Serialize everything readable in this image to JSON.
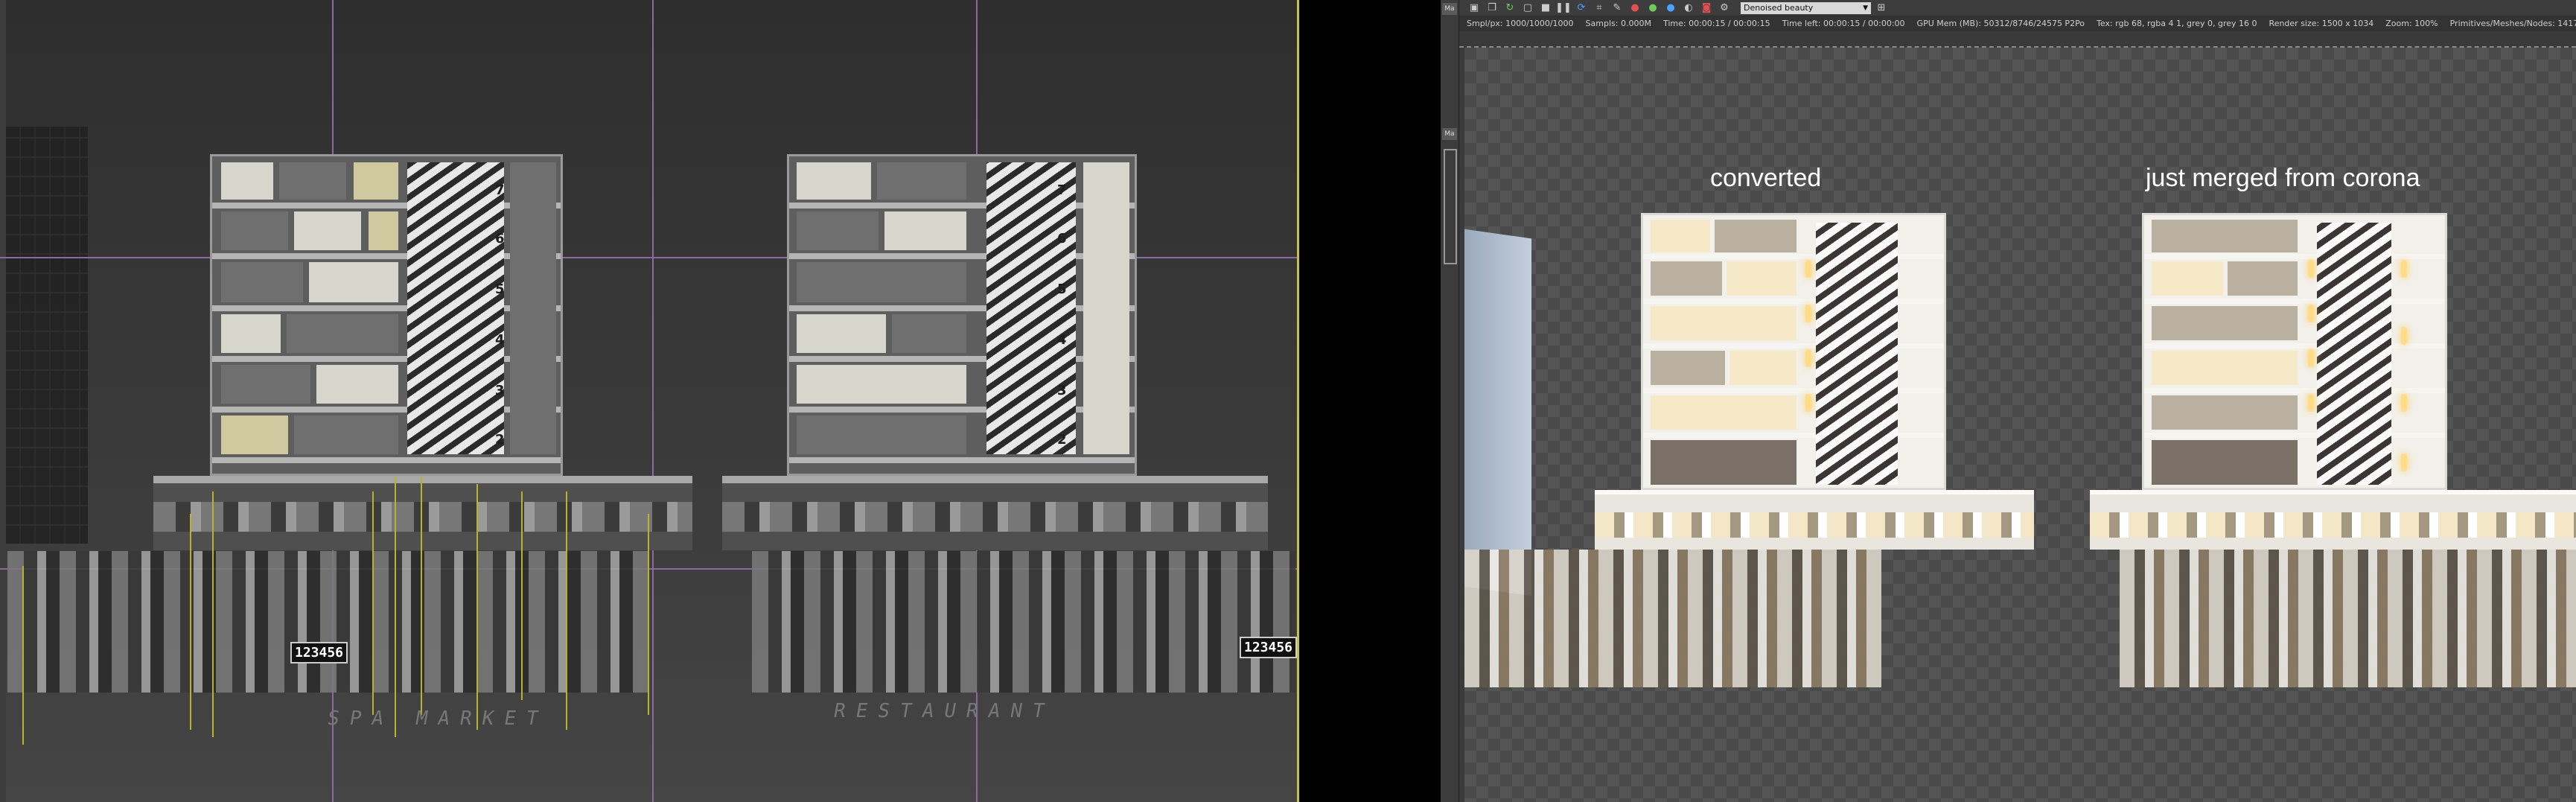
{
  "vfb": {
    "strip_labels": [
      "Ma",
      "Ma"
    ],
    "channel": "Denoised beauty",
    "stats": [
      "Smpl/px: 1000/1000/1000",
      "Sampls: 0.000M",
      "Time: 00:00:15 / 00:00:15",
      "Time left: 00:00:15 / 00:00:00",
      "GPU Mem (MB): 50312/8746/24575 P2Po",
      "Tex: rgb 68, rgba 4 1, grey 0, grey 16 0",
      "Render size: 1500 x 1034",
      "Zoom: 100%",
      "Primitives/Meshes/Nodes: 14178/4/13620"
    ],
    "caption_left": "converted",
    "caption_right": "just merged from corona"
  },
  "viewport": {
    "floor_label_left": "SPA MARKET",
    "floor_label_right": "RESTAURANT",
    "sign_left": "123456",
    "sign_right": "123456",
    "left_building_numbers": [
      "7",
      "6",
      "5",
      "4",
      "3",
      "2"
    ],
    "right_building_numbers": [
      "7",
      "6",
      "5",
      "4",
      "3",
      "2"
    ]
  },
  "icons": {
    "toolbar": [
      "save-icon",
      "copy-icon",
      "refresh-icon",
      "clear-icon",
      "stop-icon",
      "pause-icon",
      "rerender-icon",
      "region-icon",
      "color-picker-icon",
      "red-channel-icon",
      "green-channel-icon",
      "blue-channel-icon",
      "alpha-channel-icon",
      "camera-icon",
      "settings-icon",
      "lock-icon"
    ]
  }
}
